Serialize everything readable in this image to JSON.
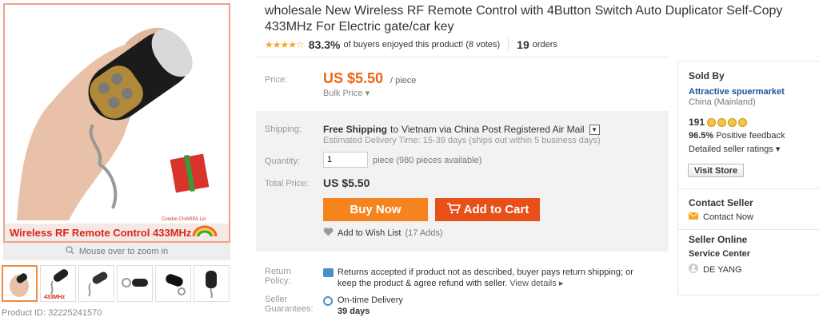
{
  "gallery": {
    "image_banner_text": "Wireless RF Remote Control  433MHz",
    "watermark": "Condre CHARPA.Lin",
    "zoom_hint": "Mouse over to zoom in",
    "thumb_label": "433MHz",
    "product_id": "Product ID: 32225241570"
  },
  "product": {
    "title": "wholesale New Wireless RF Remote Control with 4Button Switch Auto Duplicator Self-Copy 433MHz For Electric gate/car key",
    "rating_percent": "83.3%",
    "rating_text": "of buyers enjoyed this product! (8 votes)",
    "orders_count": "19",
    "orders_label": "orders"
  },
  "price": {
    "label": "Price:",
    "value": "US $5.50",
    "per": "/ piece",
    "bulk": "Bulk Price"
  },
  "shipping": {
    "label": "Shipping:",
    "free": "Free Shipping",
    "to": "to",
    "destination": "Vietnam via China Post Registered Air Mail",
    "estimate": "Estimated Delivery Time: 15-39 days (ships out within 5 business days)"
  },
  "quantity": {
    "label": "Quantity:",
    "value": "1",
    "note": "piece (980 pieces available)"
  },
  "total": {
    "label": "Total Price:",
    "value": "US $5.50"
  },
  "actions": {
    "buy_now": "Buy Now",
    "add_to_cart": "Add to Cart",
    "wish_list": "Add to Wish List",
    "wish_count": "(17 Adds)"
  },
  "returns": {
    "label": "Return Policy:",
    "text": "Returns accepted if product not as described, buyer pays return shipping; or keep the product & agree refund with seller.",
    "view_details": "View details"
  },
  "guarantee": {
    "label": "Seller Guarantees:",
    "title": "On-time Delivery",
    "days": "39 days"
  },
  "seller": {
    "sold_by": "Sold By",
    "store_name": "Attractive spuermarket",
    "location": "China (Mainland)",
    "score": "191",
    "feedback_pct": "96.5%",
    "feedback_label": "Positive feedback",
    "detailed_ratings": "Detailed seller ratings",
    "visit_store": "Visit Store",
    "contact_heading": "Contact Seller",
    "contact_now": "Contact Now",
    "online_heading": "Seller Online",
    "service_center": "Service Center",
    "agent_name": "DE YANG"
  },
  "colors": {
    "accent_orange": "#f0640f",
    "buy_now": "#f5841f",
    "add_to_cart": "#e8501a",
    "link_blue": "#1c4f9c"
  }
}
